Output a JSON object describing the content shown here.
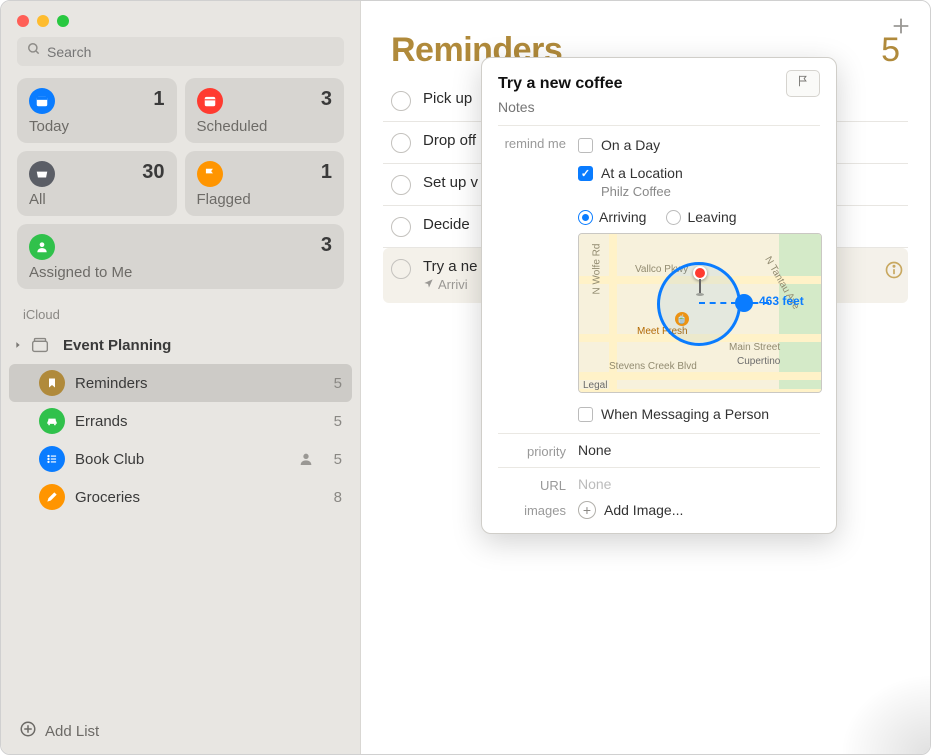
{
  "search": {
    "placeholder": "Search"
  },
  "smart_lists": {
    "today": {
      "label": "Today",
      "count": 1,
      "color": "#0a7cff"
    },
    "scheduled": {
      "label": "Scheduled",
      "count": 3,
      "color": "#ff3b30"
    },
    "all": {
      "label": "All",
      "count": 30,
      "color": "#5b5e66"
    },
    "flagged": {
      "label": "Flagged",
      "count": 1,
      "color": "#ff9500"
    },
    "assigned": {
      "label": "Assigned to Me",
      "count": 3,
      "color": "#30c14b"
    }
  },
  "account_header": "iCloud",
  "group": {
    "name": "Event Planning"
  },
  "lists": [
    {
      "name": "Reminders",
      "count": 5,
      "color": "#b08a3b",
      "icon": "bookmark",
      "selected": true,
      "shared": false
    },
    {
      "name": "Errands",
      "count": 5,
      "color": "#30c14b",
      "icon": "car",
      "selected": false,
      "shared": false
    },
    {
      "name": "Book Club",
      "count": 5,
      "color": "#0a7cff",
      "icon": "list",
      "selected": false,
      "shared": true
    },
    {
      "name": "Groceries",
      "count": 8,
      "color": "#ff9500",
      "icon": "pencil",
      "selected": false,
      "shared": false
    }
  ],
  "add_list_label": "Add List",
  "main": {
    "title": "Reminders",
    "count": 5
  },
  "tasks": [
    {
      "title": "Pick up",
      "sub": ""
    },
    {
      "title": "Drop off",
      "sub": ""
    },
    {
      "title": "Set up v",
      "sub": ""
    },
    {
      "title": "Decide",
      "sub": ""
    },
    {
      "title": "Try a ne",
      "sub": "Arrivi",
      "selected": true
    }
  ],
  "popover": {
    "title": "Try a new coffee",
    "notes_placeholder": "Notes",
    "remind_label": "remind me",
    "on_day": {
      "label": "On a Day",
      "checked": false
    },
    "at_location": {
      "label": "At a Location",
      "checked": true,
      "place": "Philz Coffee"
    },
    "arriving_label": "Arriving",
    "leaving_label": "Leaving",
    "arrive_leave": "arriving",
    "geofence_distance": "463 feet",
    "map_labels": {
      "vallco": "Vallco Pkwy",
      "wolfe": "N Wolfe Rd",
      "tantau": "N Tantau Ave",
      "stevens": "Stevens Creek Blvd",
      "main": "Main Street",
      "cupertino": "Cupertino",
      "meetfresh": "Meet Fresh",
      "legal": "Legal"
    },
    "messaging": {
      "label": "When Messaging a Person",
      "checked": false
    },
    "priority": {
      "label": "priority",
      "value": "None"
    },
    "url": {
      "label": "URL",
      "value": "None"
    },
    "images": {
      "label": "images",
      "add_label": "Add Image..."
    }
  }
}
